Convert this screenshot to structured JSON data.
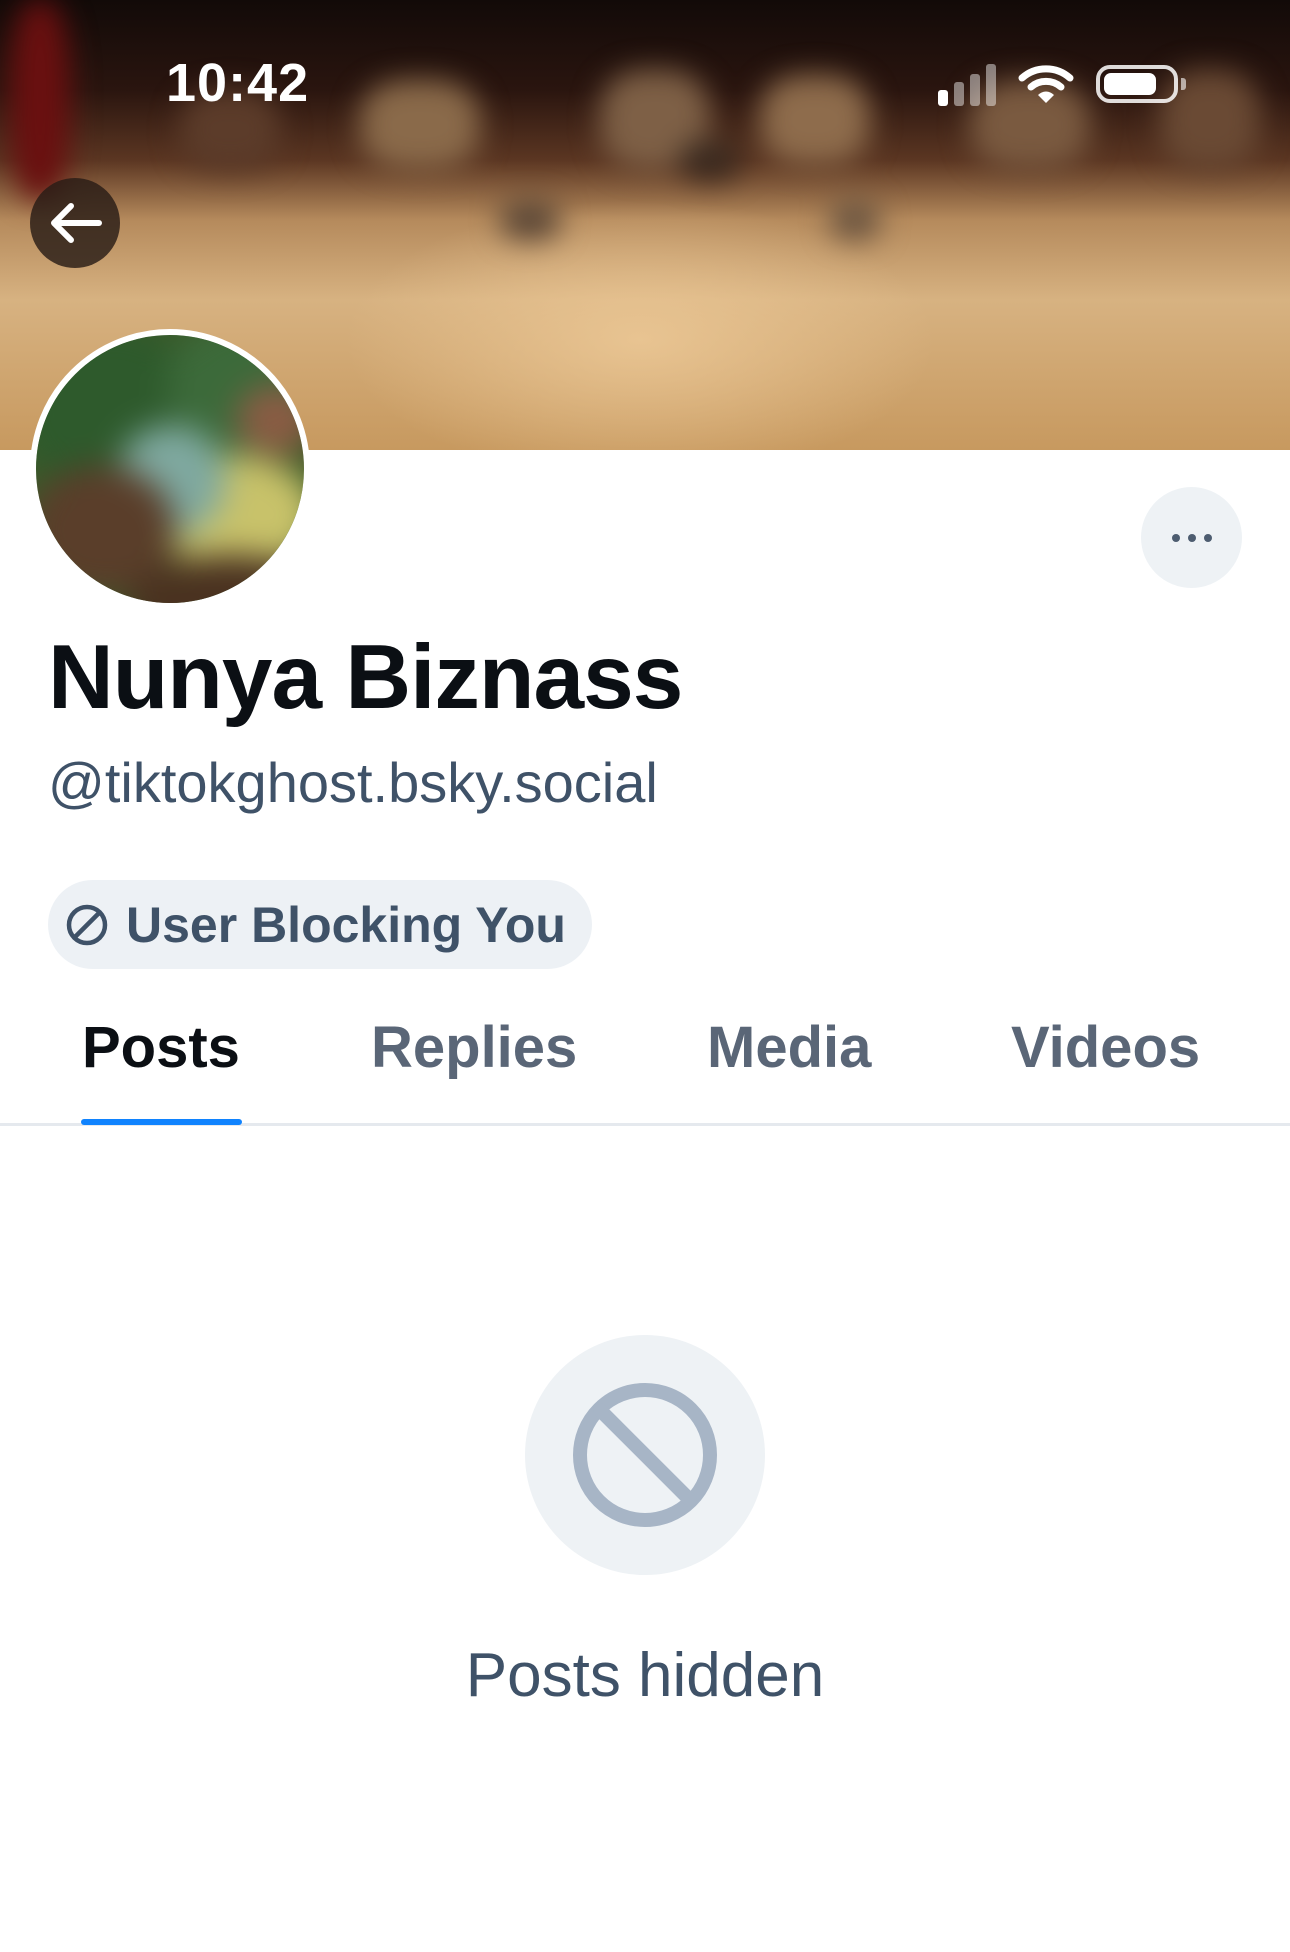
{
  "status_bar": {
    "time": "10:42",
    "signal_bars_active": 1,
    "signal_bars_total": 4
  },
  "header": {
    "back_icon": "arrow-left-icon",
    "more_icon": "ellipsis-icon"
  },
  "profile": {
    "display_name": "Nunya Biznass",
    "handle": "@tiktokghost.bsky.social",
    "blocking_label": "User Blocking You",
    "blocking_icon": "circle-slash-icon"
  },
  "tabs": [
    {
      "label": "Posts",
      "active": true
    },
    {
      "label": "Replies",
      "active": false
    },
    {
      "label": "Media",
      "active": false
    },
    {
      "label": "Videos",
      "active": false
    }
  ],
  "empty_state": {
    "icon": "circle-slash-icon",
    "text": "Posts hidden"
  },
  "colors": {
    "accent": "#1083fe",
    "text_primary": "#0b0f14",
    "text_secondary": "#3f5268",
    "pill_background": "#edf1f5"
  }
}
